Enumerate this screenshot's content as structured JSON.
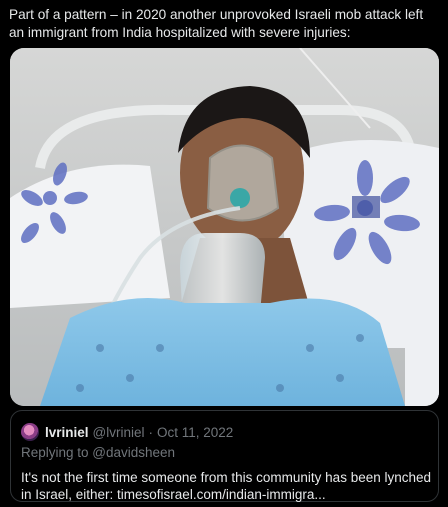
{
  "tweet": {
    "text": "Part of a pattern – in 2020 another unprovoked Israeli mob attack left an immigrant from India hospitalized with severe injuries:"
  },
  "quote": {
    "display_name": "lvriniel",
    "handle": "@lvriniel",
    "separator": "·",
    "date": "Oct 11, 2022",
    "replying_to": "Replying to @davidsheen",
    "body": "It's not the first time someone from this community has been lynched in Israel, either: timesofisrael.com/indian-immigra..."
  },
  "colors": {
    "background": "#000000",
    "text": "#e7e9ea",
    "muted": "#71767b",
    "border": "#2f3336"
  }
}
